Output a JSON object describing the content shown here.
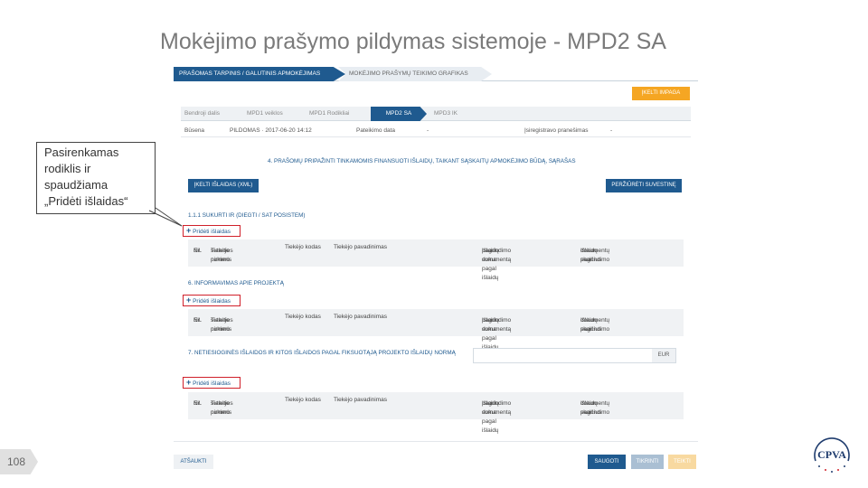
{
  "slide": {
    "title": "Mokėjimo prašymo pildymas sistemoje - MPD2 SA",
    "page_number": "108",
    "callout": [
      "Pasirenkamas",
      "rodiklis ir",
      "spaudžiama",
      "„Pridėti išlaidas“"
    ]
  },
  "app": {
    "top_tabs": [
      "PRAŠOMAS TARPINIS / GALUTINIS APMOKĖJIMAS",
      "MOKĖJIMO PRAŠYMŲ TEIKIMO GRAFIKAS"
    ],
    "import_button": "ĮKELTI IMPAGA",
    "tabs": [
      "Bendroji dalis",
      "MPD1 veiklos",
      "MPD1 Rodikliai",
      "MPD2 SA",
      "MPD3 IK"
    ],
    "info": {
      "status_label": "Būsena",
      "status_value": "PILDOMAS · 2017-06-20 14:12",
      "submit_label": "Pateikimo data",
      "submit_value": "-",
      "deadline_label": "Įsiregistravo pranešimas",
      "deadline_value": "-"
    },
    "section1_title": "4. PRAŠOMŲ PRIPAŽINTI TINKAMOMIS FINANSUOTI IŠLAIDŲ, TAIKANT SĄSKAITŲ APMOKĖJIMO BŪDĄ, SĄRAŠAS",
    "upload_button": "ĮKELTI IŠLAIDAS (XML)",
    "summary_button": "PERŽIŪRĖTI SUVESTINĘ",
    "subsection_title": "1.1.1 SUKURTI IR (DIEGTI / SAT POSISTEM)",
    "add_label": "Pridėti išlaidas",
    "columns": {
      "c1": [
        "Eil.",
        "Nr."
      ],
      "c2": [
        "Tiekėjo pirkimo",
        "sutarties numeris"
      ],
      "c3": "Tiekėjo kodas",
      "c4": "Tiekėjo pavadinimas",
      "c5": [
        "Išlaidų suma pagal išlaidų",
        "pagrindimo dokumentą"
      ],
      "c6": [
        "Išlaidų pagrindimo",
        "dokumentų skaičius"
      ]
    },
    "section2_title": "6. INFORMAVIMAS APIE PROJEKTĄ",
    "section3_title": "7. NETIESIOGINĖS IŠLAIDOS IR KITOS IŠLAIDOS PAGAL FIKSUOTĄJĄ PROJEKTO IŠLAIDŲ NORMĄ",
    "currency": "EUR",
    "footer": {
      "cancel": "ATŠAUKTI",
      "save": "SAUGOTI",
      "check": "TIKRINTI",
      "submit": "TEIKTI"
    }
  },
  "logo": {
    "text": "CPVA"
  },
  "colors": {
    "primary": "#1f5a8f",
    "accent": "#f5a623",
    "highlight": "#d0202a"
  }
}
